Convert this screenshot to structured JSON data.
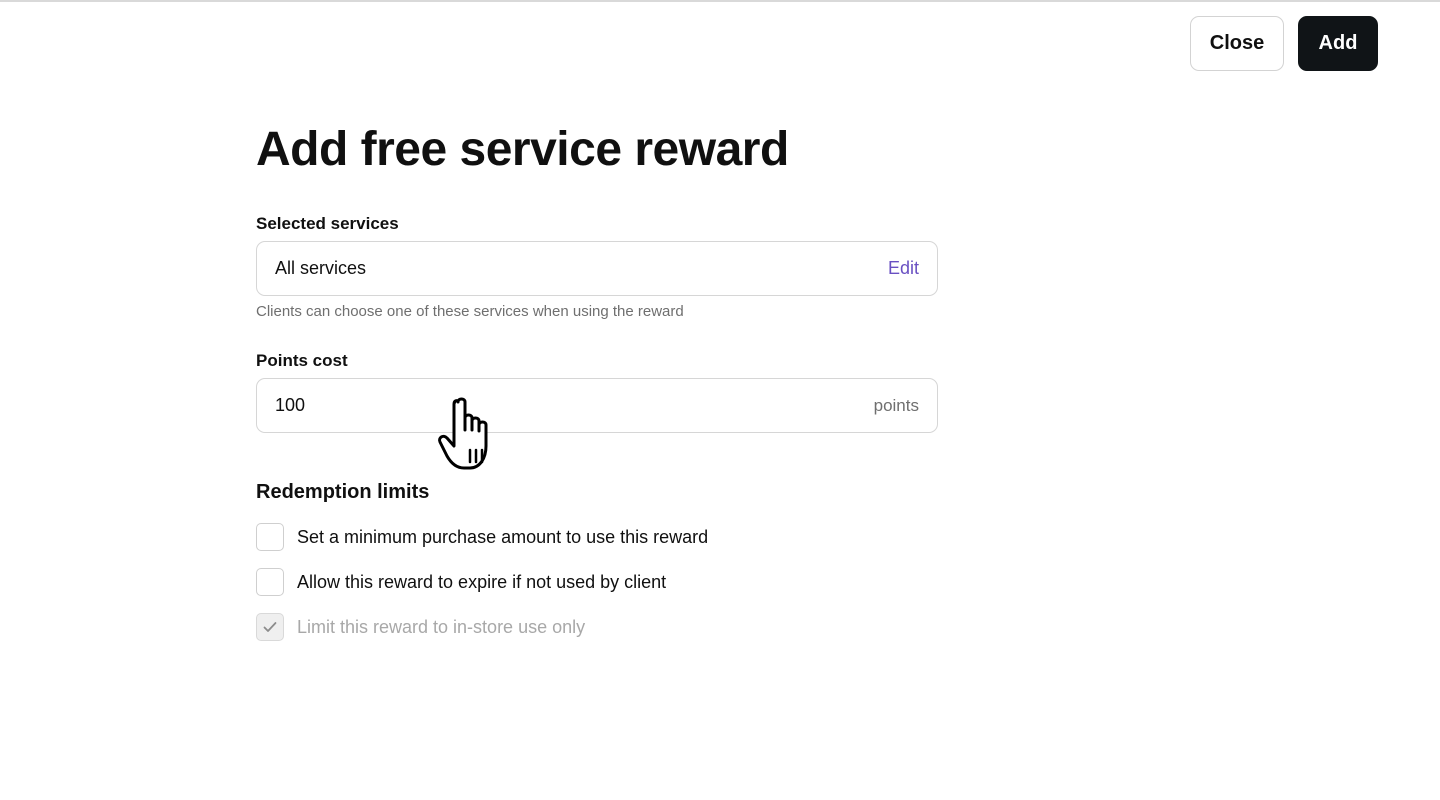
{
  "header": {
    "close_label": "Close",
    "add_label": "Add"
  },
  "page": {
    "title": "Add free service reward"
  },
  "selected_services": {
    "label": "Selected services",
    "value": "All services",
    "edit_label": "Edit",
    "hint": "Clients can choose one of these services when using the reward"
  },
  "points_cost": {
    "label": "Points cost",
    "value": "100",
    "suffix": "points"
  },
  "redemption_limits": {
    "title": "Redemption limits",
    "options": [
      {
        "label": "Set a minimum purchase amount to use this reward",
        "checked": false,
        "disabled": false
      },
      {
        "label": "Allow this reward to expire if not used by client",
        "checked": false,
        "disabled": false
      },
      {
        "label": "Limit this reward to in-store use only",
        "checked": true,
        "disabled": true
      }
    ]
  },
  "colors": {
    "primary_button": "#101417",
    "link": "#6950c2",
    "hint_text": "#6f6f6f",
    "disabled_text": "#a8a8a8"
  },
  "icons": {
    "check": "check-icon",
    "cursor": "hand-pointer-cursor-icon"
  }
}
